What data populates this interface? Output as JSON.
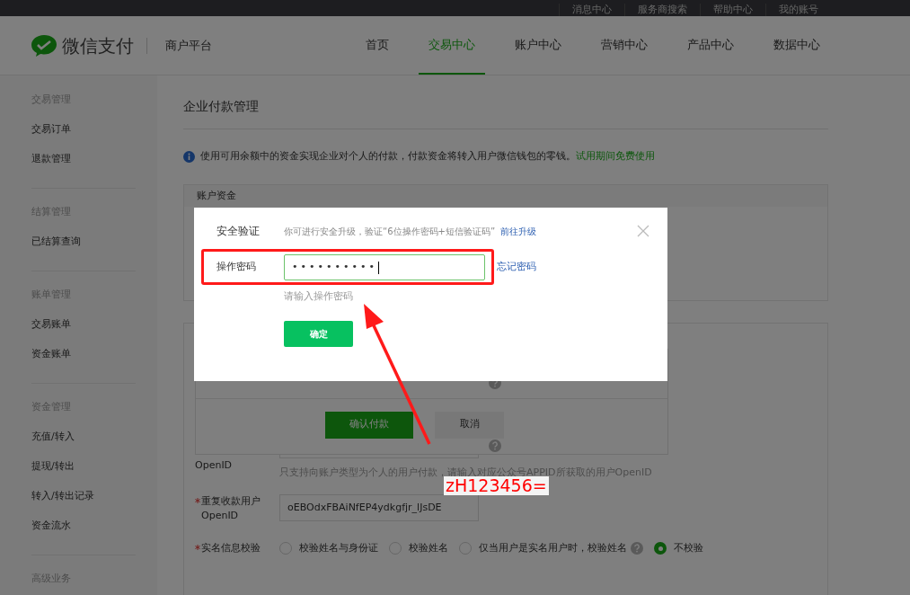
{
  "top_bar": {
    "links": [
      "消息中心",
      "服务商搜索",
      "帮助中心",
      "我的账号"
    ]
  },
  "header": {
    "brand": "微信支付",
    "platform": "商户平台",
    "nav": [
      {
        "label": "首页",
        "selected": false
      },
      {
        "label": "交易中心",
        "selected": true
      },
      {
        "label": "账户中心",
        "selected": false
      },
      {
        "label": "营销中心",
        "selected": false
      },
      {
        "label": "产品中心",
        "selected": false
      },
      {
        "label": "数据中心",
        "selected": false
      }
    ]
  },
  "sidebar": {
    "groups": [
      {
        "title": "交易管理",
        "items": [
          "交易订单",
          "退款管理"
        ]
      },
      {
        "title": "结算管理",
        "items": [
          "已结算查询"
        ]
      },
      {
        "title": "账单管理",
        "items": [
          "交易账单",
          "资金账单"
        ]
      },
      {
        "title": "资金管理",
        "items": [
          "充值/转入",
          "提现/转出",
          "转入/转出记录",
          "资金流水"
        ]
      },
      {
        "title": "高级业务"
      }
    ]
  },
  "page": {
    "title": "企业付款管理",
    "notice": "使用可用余额中的资金实现企业对个人的付款，付款资金将转入用户微信钱包的零钱。",
    "notice_link": "试用期间免费使用",
    "account_card_title": "账户资金",
    "confirm_buttons": [
      "确认付款",
      "取消"
    ],
    "form": {
      "openid_label": "OpenID",
      "openid_hint": "只支持向账户类型为个人的用户付款，请输入对应公众号APPID所获取的用户OpenID",
      "repeat_label": [
        "重复收款用户",
        "OpenID"
      ],
      "repeat_value": "oEBOdxFBAiNfEP4ydkgfjr_lJsDE",
      "check_label": "实名信息校验",
      "check_options": [
        {
          "label": "校验姓名与身份证",
          "selected": false,
          "help": false
        },
        {
          "label": "校验姓名",
          "selected": false,
          "help": false
        },
        {
          "label": "仅当用户是实名用户时，校验姓名",
          "selected": false,
          "help": true
        },
        {
          "label": "不校验",
          "selected": true,
          "help": false
        }
      ]
    }
  },
  "dialog": {
    "title": "安全验证",
    "tip": "你可进行安全升级，验证“6位操作密码+短信验证码”",
    "tip_link": "前往升级",
    "field_label": "操作密码",
    "value": "••••••••••",
    "forgot": "忘记密码",
    "hint": "请输入操作密码",
    "confirm": "确定"
  },
  "annotation": {
    "text": "zH123456="
  }
}
